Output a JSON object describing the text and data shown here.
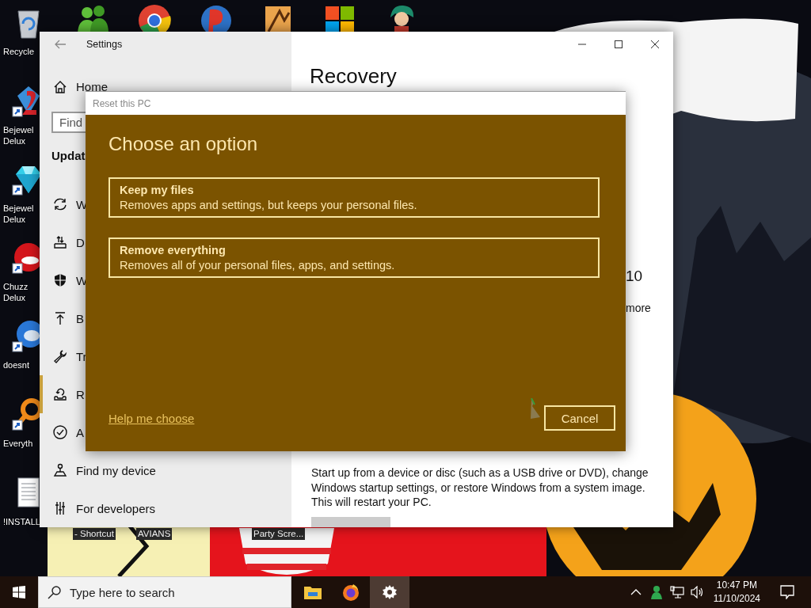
{
  "desktop": {
    "top_icons": [
      {
        "kind": "people"
      },
      {
        "kind": "ring"
      },
      {
        "kind": "ball"
      },
      {
        "kind": "game-box"
      },
      {
        "kind": "four-squares"
      },
      {
        "kind": "figure"
      }
    ],
    "left_icons": [
      {
        "kind": "recycle-bin",
        "lines": [
          "Recycle"
        ],
        "shortcut": false
      },
      {
        "kind": "red-gem",
        "lines": [
          "Bejewel",
          "Delux"
        ],
        "shortcut": true
      },
      {
        "kind": "blue-gem",
        "lines": [
          "Bejewel",
          "Delux"
        ],
        "shortcut": true
      },
      {
        "kind": "red-blob",
        "lines": [
          "Chuzz",
          "Delux"
        ],
        "shortcut": true
      },
      {
        "kind": "blue-orb",
        "lines": [
          "doesnt"
        ],
        "shortcut": true
      },
      {
        "kind": "magnifier",
        "lines": [
          "Everyth"
        ],
        "shortcut": true
      },
      {
        "kind": "document",
        "lines": [
          "!INSTALL"
        ],
        "shortcut": false
      }
    ],
    "bottom_labels": [
      "- Shortcut",
      "AVIANS",
      "Party Scre..."
    ]
  },
  "settings": {
    "title": "Settings",
    "home": "Home",
    "search_placeholder": "Find",
    "section": "Updat",
    "items": [
      {
        "label": "W",
        "kind": "sync",
        "selected": false
      },
      {
        "label": "D",
        "kind": "delivery",
        "selected": false
      },
      {
        "label": "W",
        "kind": "shield",
        "selected": false
      },
      {
        "label": "B",
        "kind": "backup",
        "selected": false
      },
      {
        "label": "Tr",
        "kind": "troubleshoot",
        "selected": false
      },
      {
        "label": "R",
        "kind": "recovery",
        "selected": true
      },
      {
        "label": "A",
        "kind": "activation",
        "selected": false
      },
      {
        "label": "Find my device",
        "kind": "find-device",
        "selected": false
      },
      {
        "label": "For developers",
        "kind": "developers",
        "selected": false
      }
    ],
    "page_title": "Recovery",
    "fragment_1": "10",
    "fragment_2": "more",
    "description": "Start up from a device or disc (such as a USB drive or DVD), change Windows startup settings, or restore Windows from a system image. This will restart your PC."
  },
  "dialog": {
    "title": "Reset this PC",
    "heading": "Choose an option",
    "options": [
      {
        "title": "Keep my files",
        "description": "Removes apps and settings, but keeps your personal files."
      },
      {
        "title": "Remove everything",
        "description": "Removes all of your personal files, apps, and settings."
      }
    ],
    "help_link": "Help me choose",
    "cancel": "Cancel"
  },
  "taskbar": {
    "search_placeholder": "Type here to search",
    "apps": [
      {
        "kind": "folder",
        "selected": false
      },
      {
        "kind": "globe",
        "selected": false
      },
      {
        "kind": "settings",
        "selected": true
      }
    ],
    "time": "10:47 PM",
    "date": "11/10/2024"
  }
}
